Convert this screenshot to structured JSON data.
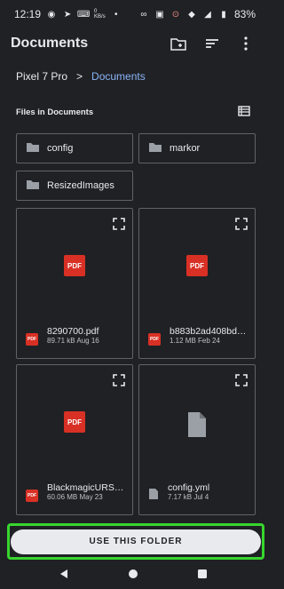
{
  "status": {
    "time": "12:19",
    "small_text": "0\nKB/s",
    "battery": "83%",
    "icons": [
      "settings-indicator-icon",
      "send-icon",
      "keyboard-icon",
      "data-speed-icon",
      "dot-icon",
      "link-icon",
      "vibrate-icon",
      "record-icon",
      "wifi-icon",
      "signal-icon",
      "battery-icon"
    ]
  },
  "appbar": {
    "title": "Documents",
    "actions": [
      "new-folder-icon",
      "sort-icon",
      "more-vert-icon"
    ]
  },
  "breadcrumb": {
    "root": "Pixel 7 Pro",
    "separator": ">",
    "current": "Documents"
  },
  "section": {
    "title": "Files in Documents",
    "view_icon": "list-view-icon"
  },
  "folders": [
    {
      "name": "config"
    },
    {
      "name": "markor"
    },
    {
      "name": "ResizedImages"
    }
  ],
  "files": [
    {
      "name": "8290700.pdf",
      "meta": "89.71 kB Aug 16",
      "type": "pdf",
      "thumb": "PDF"
    },
    {
      "name": "b883b2ad408bd…",
      "meta": "1.12 MB Feb 24",
      "type": "pdf",
      "thumb": "PDF"
    },
    {
      "name": "BlackmagicURS…",
      "meta": "60.06 MB May 23",
      "type": "pdf",
      "thumb": "PDF"
    },
    {
      "name": "config.yml",
      "meta": "7.17 kB Jul 4",
      "type": "generic",
      "thumb": ""
    }
  ],
  "use_button": "USE THIS FOLDER",
  "nav": [
    "back-icon",
    "home-icon",
    "recents-icon"
  ]
}
